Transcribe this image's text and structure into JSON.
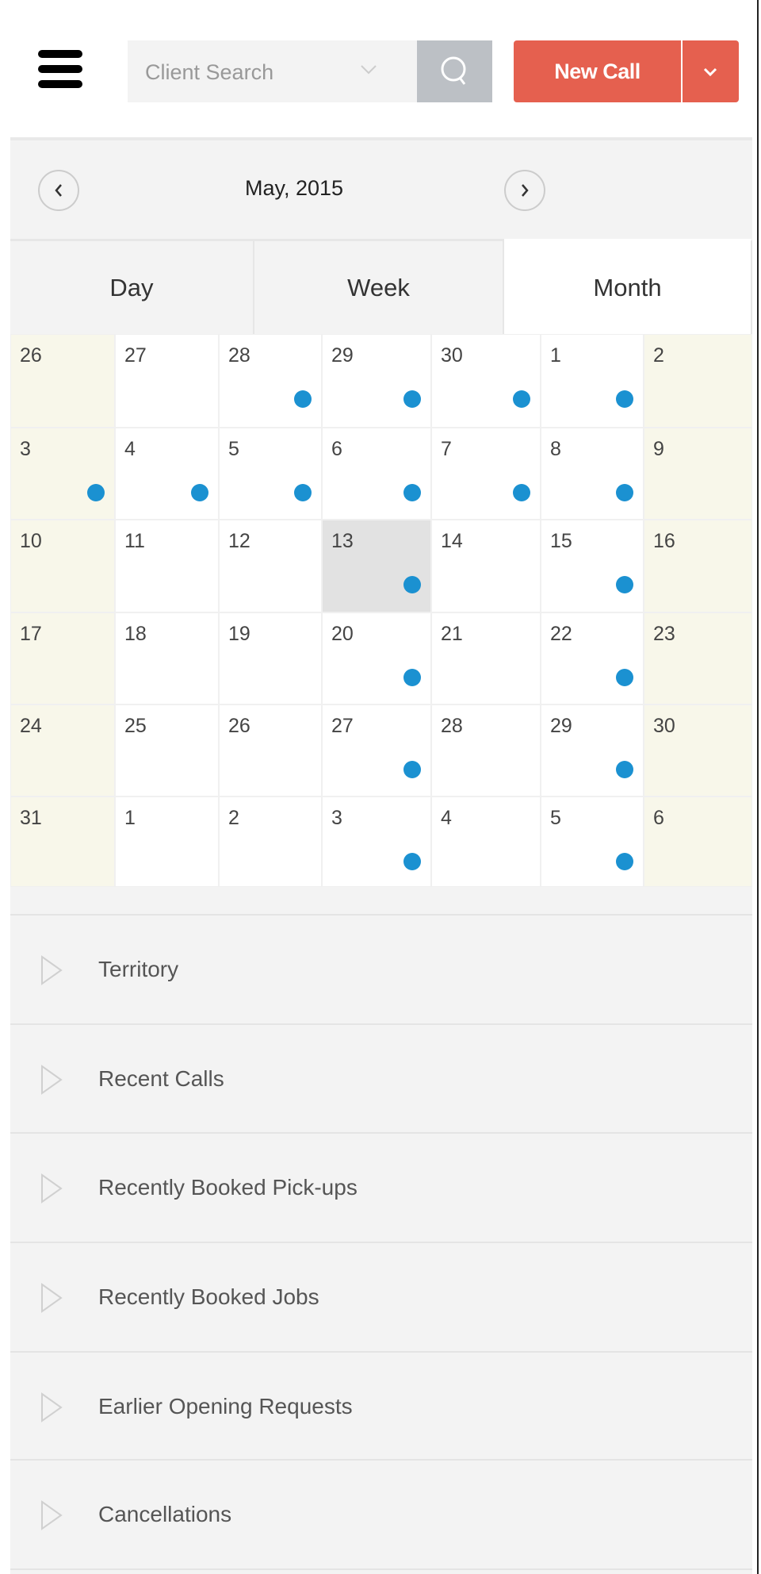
{
  "header": {
    "menu_icon": "hamburger-icon",
    "search_placeholder": "Client Search",
    "search_icon": "search-icon",
    "new_call_label": "New Call",
    "accent_color": "#e5604f"
  },
  "calendar": {
    "month_title": "May, 2015",
    "tabs": [
      {
        "label": "Day",
        "active": false
      },
      {
        "label": "Week",
        "active": false
      },
      {
        "label": "Month",
        "active": true
      }
    ],
    "event_dot_color": "#1b91d1",
    "weeks": [
      {
        "days": [
          {
            "day": "26",
            "dot": false
          },
          {
            "day": "27",
            "dot": false
          },
          {
            "day": "28",
            "dot": true
          },
          {
            "day": "29",
            "dot": true
          },
          {
            "day": "30",
            "dot": true
          },
          {
            "day": "1",
            "dot": true
          },
          {
            "day": "2",
            "dot": false
          }
        ]
      },
      {
        "days": [
          {
            "day": "3",
            "dot": true
          },
          {
            "day": "4",
            "dot": true
          },
          {
            "day": "5",
            "dot": true
          },
          {
            "day": "6",
            "dot": true
          },
          {
            "day": "7",
            "dot": true
          },
          {
            "day": "8",
            "dot": true
          },
          {
            "day": "9",
            "dot": false
          }
        ]
      },
      {
        "days": [
          {
            "day": "10",
            "dot": false
          },
          {
            "day": "11",
            "dot": false
          },
          {
            "day": "12",
            "dot": false
          },
          {
            "day": "13",
            "dot": true,
            "today": true
          },
          {
            "day": "14",
            "dot": false
          },
          {
            "day": "15",
            "dot": true
          },
          {
            "day": "16",
            "dot": false
          }
        ]
      },
      {
        "days": [
          {
            "day": "17",
            "dot": false
          },
          {
            "day": "18",
            "dot": false
          },
          {
            "day": "19",
            "dot": false
          },
          {
            "day": "20",
            "dot": true
          },
          {
            "day": "21",
            "dot": false
          },
          {
            "day": "22",
            "dot": true
          },
          {
            "day": "23",
            "dot": false
          }
        ]
      },
      {
        "days": [
          {
            "day": "24",
            "dot": false
          },
          {
            "day": "25",
            "dot": false
          },
          {
            "day": "26",
            "dot": false
          },
          {
            "day": "27",
            "dot": true
          },
          {
            "day": "28",
            "dot": false
          },
          {
            "day": "29",
            "dot": true
          },
          {
            "day": "30",
            "dot": false
          }
        ]
      },
      {
        "days": [
          {
            "day": "31",
            "dot": false
          },
          {
            "day": "1",
            "dot": false
          },
          {
            "day": "2",
            "dot": false
          },
          {
            "day": "3",
            "dot": true
          },
          {
            "day": "4",
            "dot": false
          },
          {
            "day": "5",
            "dot": true
          },
          {
            "day": "6",
            "dot": false
          }
        ]
      }
    ]
  },
  "sections": [
    {
      "label": "Territory"
    },
    {
      "label": "Recent Calls"
    },
    {
      "label": "Recently Booked Pick-ups"
    },
    {
      "label": "Recently Booked Jobs"
    },
    {
      "label": "Earlier Opening Requests"
    },
    {
      "label": "Cancellations"
    }
  ]
}
